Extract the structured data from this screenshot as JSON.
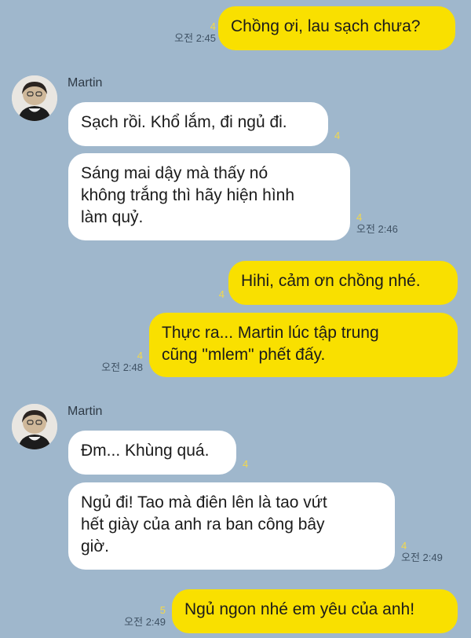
{
  "chat": {
    "messages": [
      {
        "side": "me",
        "text": "Chồng ơi, lau sạch chưa?",
        "unread": "4",
        "time": "오전 2:45"
      },
      {
        "side": "them",
        "sender": "Martin",
        "text": "Sạch rồi. Khổ lắm, đi ngủ đi.",
        "unread": "4",
        "time": ""
      },
      {
        "side": "them",
        "text": "Sáng mai dậy mà thấy nó\nkhông trắng thì hãy hiện hình\nlàm quỷ.",
        "unread": "4",
        "time": "오전 2:46"
      },
      {
        "side": "me",
        "text": "Hihi, cảm ơn chồng nhé.",
        "unread": "4",
        "time": ""
      },
      {
        "side": "me",
        "text": "Thực ra... Martin lúc tập trung\ncũng \"mlem\" phết đấy.",
        "unread": "4",
        "time": "오전 2:48"
      },
      {
        "side": "them",
        "sender": "Martin",
        "text": "Đm... Khùng quá.",
        "unread": "4",
        "time": ""
      },
      {
        "side": "them",
        "text": "Ngủ đi! Tao mà điên lên là tao vứt\nhết giày của anh ra ban công bây\ngiờ.",
        "unread": "4",
        "time": "오전 2:49"
      },
      {
        "side": "me",
        "text": "Ngủ ngon nhé em yêu của anh!",
        "unread": "5",
        "time": "오전 2:49"
      }
    ]
  },
  "colors": {
    "background": "#9fb7cc",
    "my_bubble": "#f9e000",
    "their_bubble": "#ffffff",
    "unread": "#f2d84c"
  },
  "icons": {
    "avatar": "profile-photo-martin"
  }
}
